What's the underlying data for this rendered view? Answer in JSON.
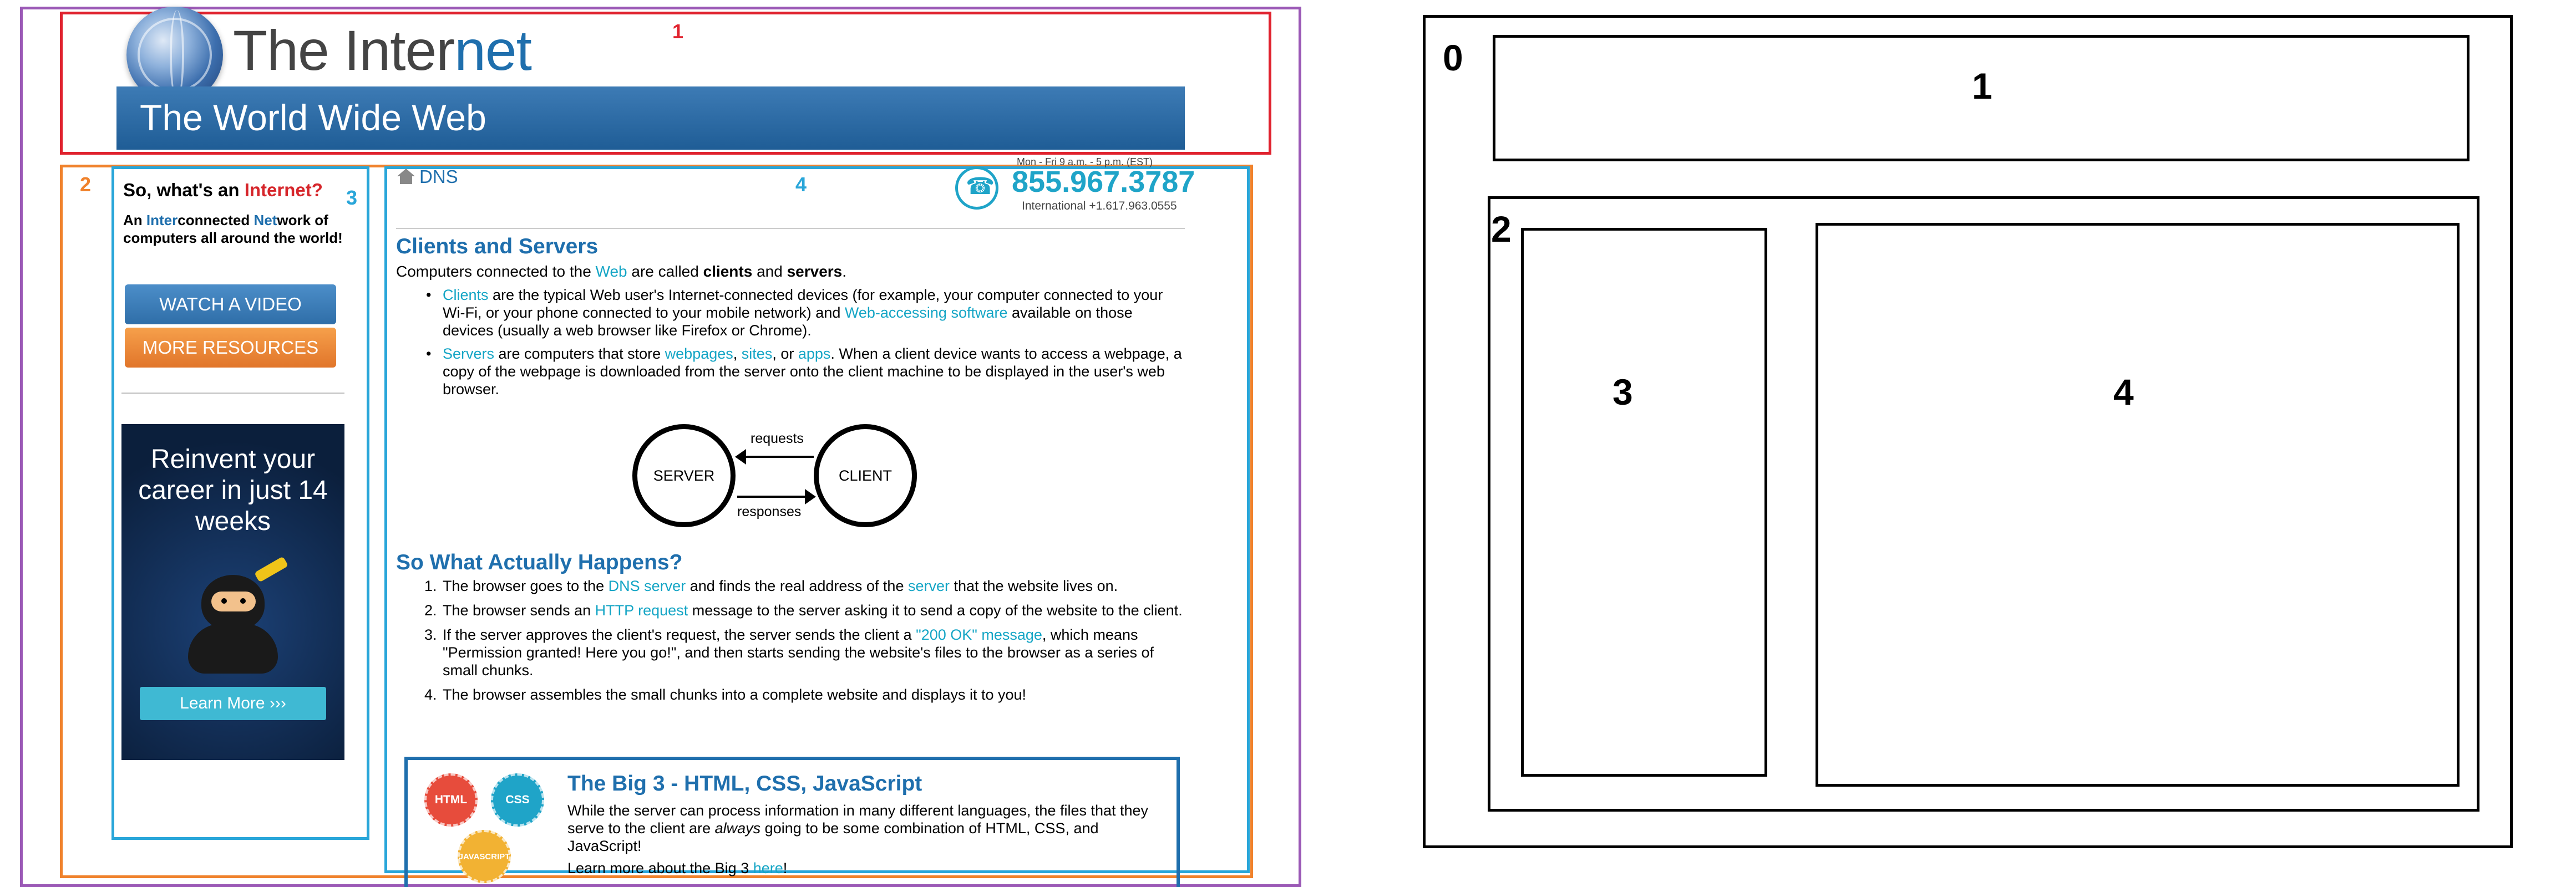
{
  "annotations": {
    "left_labels": [
      "1",
      "2",
      "3",
      "4"
    ],
    "wireframe_labels": [
      "0",
      "1",
      "2",
      "3",
      "4"
    ]
  },
  "header": {
    "title_prefix": "The Inter",
    "title_highlight": "net",
    "banner": "The World Wide Web"
  },
  "sidebar": {
    "question_prefix": "So, what's an ",
    "question_highlight": "Internet?",
    "desc_parts": [
      "An ",
      "Inter",
      "connected ",
      "Net",
      "work of computers all around the world!"
    ],
    "watch_video": "WATCH A VIDEO",
    "more_resources": "MORE RESOURCES",
    "ad_text": "Reinvent your career in just 14 weeks",
    "ad_button": "Learn More ›››"
  },
  "main": {
    "breadcrumb": "DNS",
    "hours": "Mon - Fri 9 a.m. - 5 p.m. (EST)",
    "phone": "855.967.3787",
    "intl": "International +1.617.963.0555",
    "section1_title": "Clients and Servers",
    "intro": {
      "a": "Computers connected to the ",
      "link": "Web",
      "b": " are called ",
      "c": "clients",
      "d": " and ",
      "e": "servers",
      "f": "."
    },
    "bullet1": {
      "link1": "Clients",
      "a": " are the typical Web user's Internet-connected devices (for example, your computer connected to your Wi-Fi, or your phone connected to your mobile network) and ",
      "link2": "Web-accessing software",
      "b": " available on those devices (usually a web browser like Firefox or Chrome)."
    },
    "bullet2": {
      "link1": "Servers",
      "a": " are computers that store ",
      "link2": "webpages",
      "b": ", ",
      "link3": "sites",
      "c": ", or ",
      "link4": "apps",
      "d": ". When a client device wants to access a webpage, a copy of the webpage is downloaded from the server onto the client machine to be displayed in the user's web browser."
    },
    "diagram": {
      "server": "SERVER",
      "client": "CLIENT",
      "requests": "requests",
      "responses": "responses"
    },
    "section2_title": "So What Actually Happens?",
    "steps": [
      {
        "num": "1.",
        "a": "The browser goes to the ",
        "link1": "DNS server",
        "b": " and finds the real address of the ",
        "link2": "server",
        "c": " that the website lives on."
      },
      {
        "num": "2.",
        "a": "The browser sends an ",
        "link1": "HTTP request",
        "b": " message to the server asking it to send a copy of the website to the client.",
        "link2": "",
        "c": ""
      },
      {
        "num": "3.",
        "a": "If the server approves the client's request, the server sends the client a ",
        "link1": "\"200 OK\" message",
        "b": ", which means \"Permission granted! Here you go!\", and then starts sending the website's files to the browser as a series of small chunks.",
        "link2": "",
        "c": ""
      },
      {
        "num": "4.",
        "a": "The browser assembles the small chunks into a complete website and displays it to you!",
        "link1": "",
        "b": "",
        "link2": "",
        "c": ""
      }
    ],
    "big3": {
      "badge_html": "HTML",
      "badge_css": "CSS",
      "badge_js": "JAVASCRIPT",
      "title": "The Big 3 - HTML, CSS, JavaScript",
      "text_a": "While the server can process information in many different languages, the files that they serve to the client are ",
      "text_em": "always",
      "text_b": " going to be some combination of HTML, CSS, and JavaScript!",
      "more_a": "Learn more about the Big 3 ",
      "more_link": "here",
      "more_b": "!"
    }
  }
}
